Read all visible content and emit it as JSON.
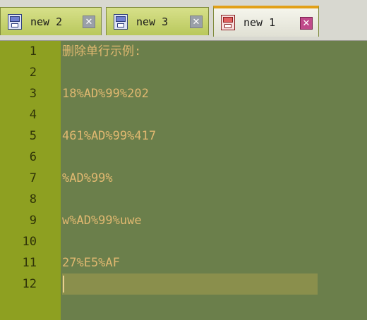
{
  "tabs": [
    {
      "label": "new  2",
      "close_glyph": "✕",
      "active": false
    },
    {
      "label": "new  3",
      "close_glyph": "✕",
      "active": false
    },
    {
      "label": "new  1",
      "close_glyph": "✕",
      "active": true
    }
  ],
  "editor": {
    "lines": [
      {
        "num": "1",
        "text": "删除单行示例:"
      },
      {
        "num": "2",
        "text": ""
      },
      {
        "num": "3",
        "text": "18%AD%99%202"
      },
      {
        "num": "4",
        "text": ""
      },
      {
        "num": "5",
        "text": "461%AD%99%417"
      },
      {
        "num": "6",
        "text": ""
      },
      {
        "num": "7",
        "text": "%AD%99%"
      },
      {
        "num": "8",
        "text": ""
      },
      {
        "num": "9",
        "text": "w%AD%99%uwe"
      },
      {
        "num": "10",
        "text": ""
      },
      {
        "num": "11",
        "text": "27%E5%AF"
      },
      {
        "num": "12",
        "text": ""
      }
    ],
    "current_line": 12
  },
  "colors": {
    "editor_bg": "#6b7f4b",
    "gutter_bg": "#8ea021",
    "text": "#e0b870",
    "line_number": "#2f3308",
    "current_line_bg": "#8a8f4c"
  }
}
